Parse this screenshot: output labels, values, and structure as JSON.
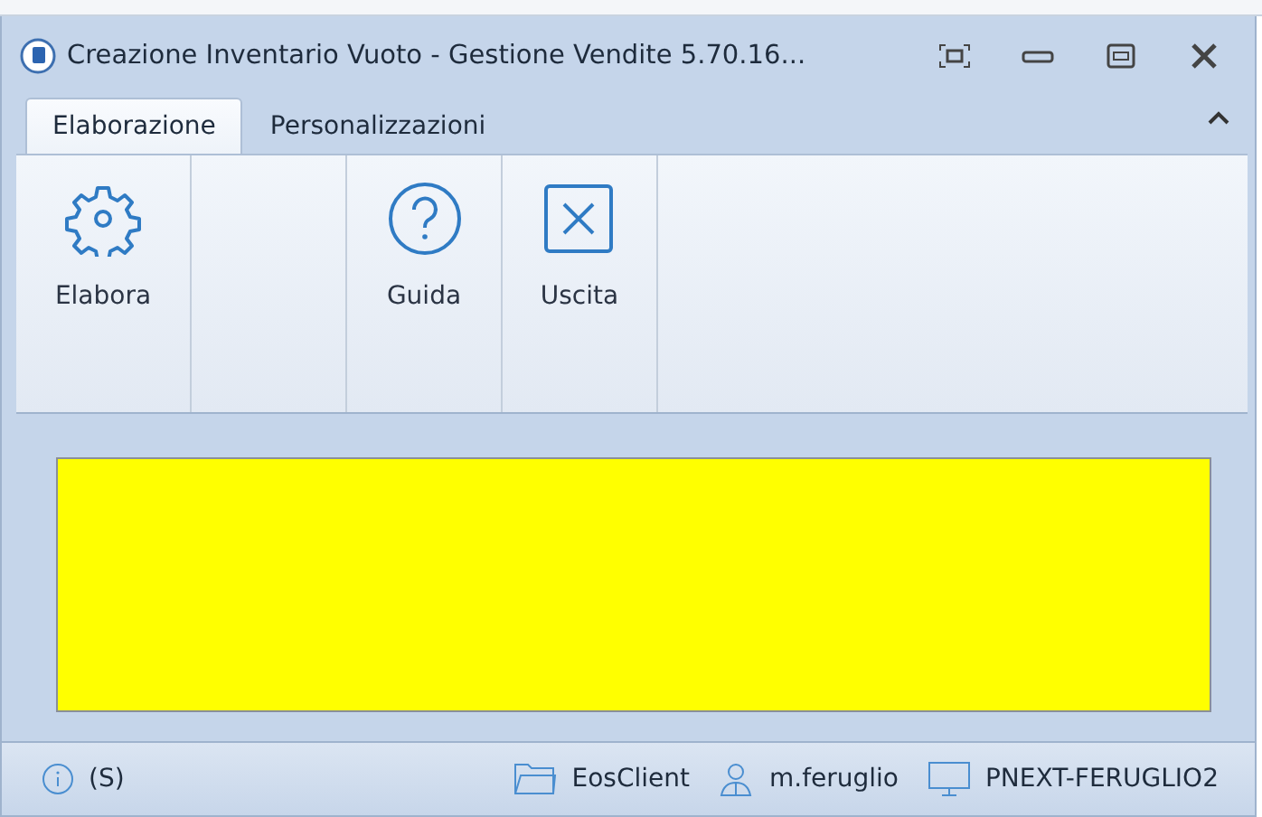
{
  "window": {
    "title": "Creazione Inventario Vuoto - Gestione Vendite 5.70.16..."
  },
  "tabs": [
    {
      "label": "Elaborazione",
      "selected": true
    },
    {
      "label": "Personalizzazioni",
      "selected": false
    }
  ],
  "ribbon": {
    "groups": [
      {
        "kind": "gear",
        "label": "Elabora"
      },
      {
        "kind": "empty"
      },
      {
        "kind": "help",
        "label": "Guida"
      },
      {
        "kind": "exit",
        "label": "Uscita"
      }
    ]
  },
  "status_bar": {
    "items": [
      {
        "kind": "info",
        "text": "(S)"
      },
      {
        "kind": "spacer"
      },
      {
        "kind": "folder",
        "text": "EosClient"
      },
      {
        "kind": "user",
        "text": "m.feruglio"
      },
      {
        "kind": "computer",
        "text": "PNEXT-FERUGLIO2"
      }
    ]
  }
}
